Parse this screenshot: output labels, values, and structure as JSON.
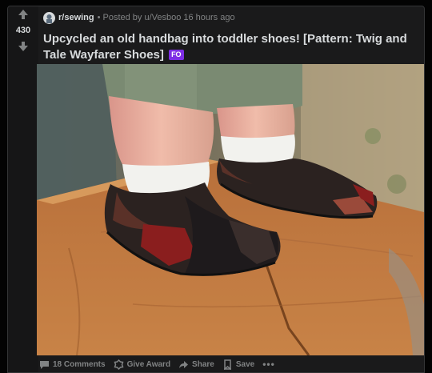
{
  "post": {
    "score": "430",
    "subreddit": "r/sewing",
    "separator": "•",
    "posted_by": "Posted by u/Vesboo",
    "time_ago": "16 hours ago",
    "title": "Upcycled an old handbag into toddler shoes! [Pattern: Twig and Tale Wayfarer Shoes]",
    "flair": "FO",
    "flair_color": "#7e2ee4"
  },
  "actions": {
    "comments_label": "18 Comments",
    "award_label": "Give Award",
    "share_label": "Share",
    "save_label": "Save",
    "more_label": "•••"
  },
  "theme": {
    "background": "#030303",
    "card": "#1a1a1b",
    "text": "#d7dadc",
    "muted": "#818384"
  },
  "icons": [
    "upvote-icon",
    "downvote-icon",
    "subreddit-icon",
    "comment-icon",
    "award-icon",
    "share-icon",
    "save-icon",
    "more-icon"
  ]
}
